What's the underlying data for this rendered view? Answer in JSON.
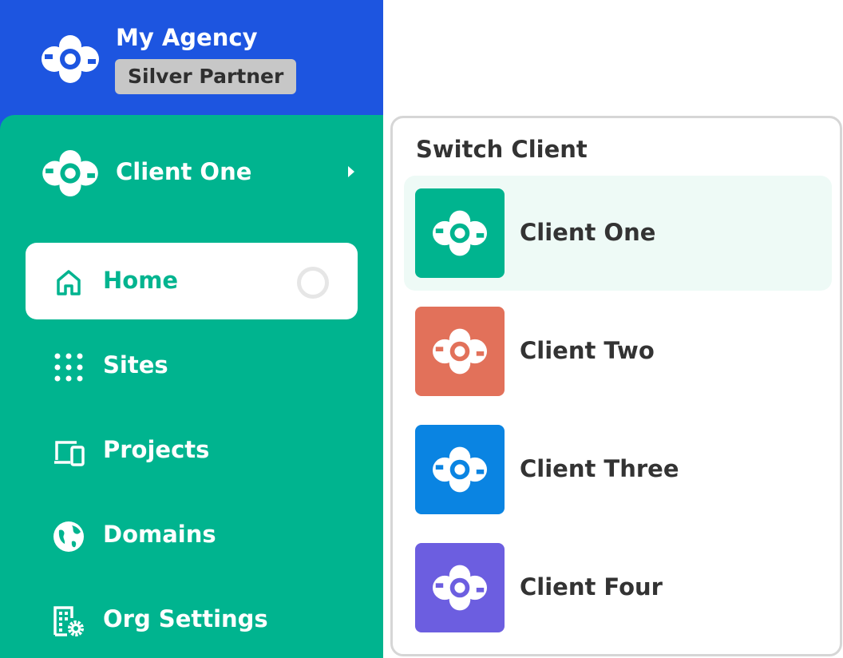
{
  "agency": {
    "name": "My Agency",
    "badge": "Silver Partner",
    "logo_icon": "cloud-ring-logo",
    "color": "#1d55e0"
  },
  "sidebar": {
    "color": "#00b48f",
    "current_client": {
      "name": "Client One",
      "logo_icon": "cloud-ring-logo"
    },
    "nav": [
      {
        "label": "Home",
        "icon": "home-icon",
        "active": true
      },
      {
        "label": "Sites",
        "icon": "grid-dots-icon",
        "active": false
      },
      {
        "label": "Projects",
        "icon": "devices-icon",
        "active": false
      },
      {
        "label": "Domains",
        "icon": "globe-icon",
        "active": false
      },
      {
        "label": "Org Settings",
        "icon": "building-gear-icon",
        "active": false
      }
    ]
  },
  "switcher": {
    "title": "Switch Client",
    "options": [
      {
        "label": "Client One",
        "color": "#00b48f",
        "selected": true
      },
      {
        "label": "Client Two",
        "color": "#e2715a",
        "selected": false
      },
      {
        "label": "Client Three",
        "color": "#0a84e2",
        "selected": false
      },
      {
        "label": "Client Four",
        "color": "#6c5ee0",
        "selected": false
      }
    ]
  }
}
